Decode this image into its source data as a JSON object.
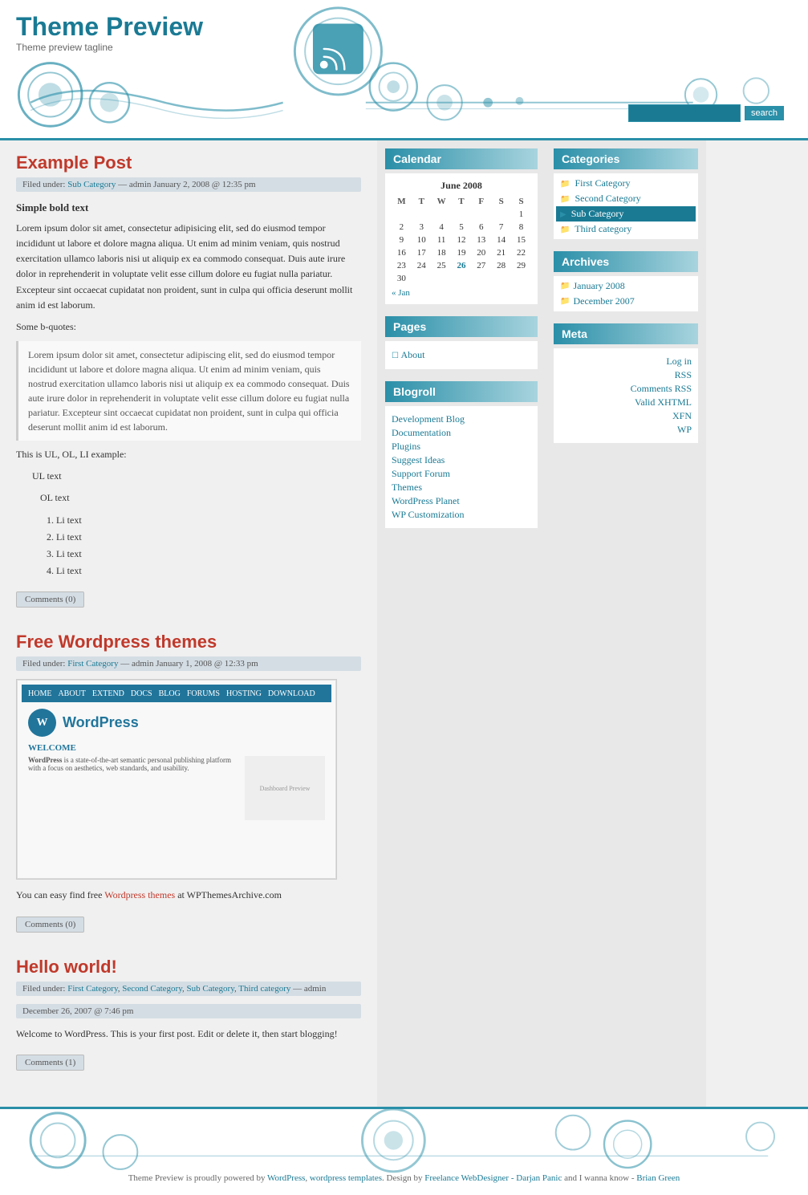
{
  "site": {
    "title": "Theme Preview",
    "tagline": "Theme preview tagline"
  },
  "search": {
    "placeholder": "",
    "button_label": "search"
  },
  "posts": [
    {
      "id": "example-post",
      "title": "Example Post",
      "meta": "Filed under: Sub Category — admin January 2, 2008 @ 12:35 pm",
      "meta_link_text": "Sub Category",
      "content_heading": "Simple bold text",
      "content_p1": "Lorem ipsum dolor sit amet, consectetur adipisicing elit, sed do eiusmod tempor incididunt ut labore et dolore magna aliqua. Ut enim ad minim veniam, quis nostrud exercitation ullamco laboris nisi ut aliquip ex ea commodo consequat. Duis aute irure dolor in reprehenderit in voluptate velit esse cillum dolore eu fugiat nulla pariatur. Excepteur sint occaecat cupidatat non proident, sunt in culpa qui officia deserunt mollit anim id est laborum.",
      "bquote_label": "Some b-quotes:",
      "blockquote": "Lorem ipsum dolor sit amet, consectetur adipiscing elit, sed do eiusmod tempor incididunt ut labore et dolore magna aliqua. Ut enim ad minim veniam, quis nostrud exercitation ullamco laboris nisi ut aliquip ex ea commodo consequat. Duis aute irure dolor in reprehenderit in voluptate velit esse cillum dolore eu fugiat nulla pariatur. Excepteur sint occaecat cupidatat non proident, sunt in culpa qui officia deserunt mollit anim id est laborum.",
      "ul_label": "This is UL, OL, LI example:",
      "ul_title": "UL text",
      "ul_items": [
        "OL text"
      ],
      "ol_items": [
        "Li text",
        "Li text",
        "Li text",
        "Li text"
      ],
      "comments_label": "Comments (0)"
    },
    {
      "id": "free-wp-themes",
      "title": "Free Wordpress themes",
      "meta": "Filed under: First Category — admin January 1, 2008 @ 12:33 pm",
      "meta_link_text": "First Category",
      "content_text": "You can easy find free",
      "content_link_text": "Wordpress themes",
      "content_text2": "at WPThemesArchive.com",
      "comments_label": "Comments (0)"
    },
    {
      "id": "hello-world",
      "title": "Hello world!",
      "meta": "Filed under: First Category, Second Category, Sub Category, Third category — admin",
      "meta_links": [
        "First Category",
        "Second Category",
        "Sub Category",
        "Third category"
      ],
      "date_meta": "December 26, 2007 @ 7:46 pm",
      "content_text": "Welcome to WordPress. This is your first post. Edit or delete it, then start blogging!",
      "comments_label": "Comments (1)"
    }
  ],
  "sidebar_left": {
    "calendar": {
      "title": "Calendar",
      "month_year": "June 2008",
      "weekdays": [
        "M",
        "T",
        "W",
        "T",
        "F",
        "S",
        "S"
      ],
      "weeks": [
        [
          "",
          "",
          "",
          "",
          "",
          "",
          "1"
        ],
        [
          "2",
          "3",
          "4",
          "5",
          "6",
          "7",
          "8"
        ],
        [
          "9",
          "10",
          "11",
          "12",
          "13",
          "14",
          "15"
        ],
        [
          "16",
          "17",
          "18",
          "19",
          "20",
          "21",
          "22"
        ],
        [
          "23",
          "24",
          "25",
          "26",
          "27",
          "28",
          "29"
        ],
        [
          "30",
          "",
          "",
          "",
          "",
          "",
          ""
        ]
      ],
      "prev_link": "« Jan",
      "next_link": ""
    },
    "pages": {
      "title": "Pages",
      "items": [
        "About"
      ]
    },
    "blogroll": {
      "title": "Blogroll",
      "items": [
        "Development Blog",
        "Documentation",
        "Plugins",
        "Suggest Ideas",
        "Support Forum",
        "Themes",
        "WordPress Planet",
        "WP Customization"
      ]
    }
  },
  "sidebar_right": {
    "categories": {
      "title": "Categories",
      "items": [
        {
          "label": "First Category",
          "active": false
        },
        {
          "label": "Second Category",
          "active": false
        },
        {
          "label": "Sub Category",
          "active": true
        },
        {
          "label": "Third category",
          "active": false
        }
      ]
    },
    "archives": {
      "title": "Archives",
      "items": [
        {
          "label": "January 2008",
          "icon": "📁"
        },
        {
          "label": "December 2007",
          "icon": "📁"
        }
      ]
    },
    "meta": {
      "title": "Meta",
      "items": [
        {
          "label": "Log in",
          "url": "#"
        },
        {
          "label": "RSS",
          "url": "#"
        },
        {
          "label": "Comments RSS",
          "url": "#"
        },
        {
          "label": "Valid XHTML",
          "url": "#"
        },
        {
          "label": "XFN",
          "url": "#"
        },
        {
          "label": "WP",
          "url": "#"
        }
      ]
    }
  },
  "footer": {
    "text": "Theme Preview is proudly powered by",
    "wp_link": "WordPress",
    "middle_text": ", wordpress templates. Design by",
    "designer_link": "Freelance WebDesigner - Darjan Panic",
    "and_text": " and I wanna know -",
    "brian_link": "Brian Green"
  }
}
